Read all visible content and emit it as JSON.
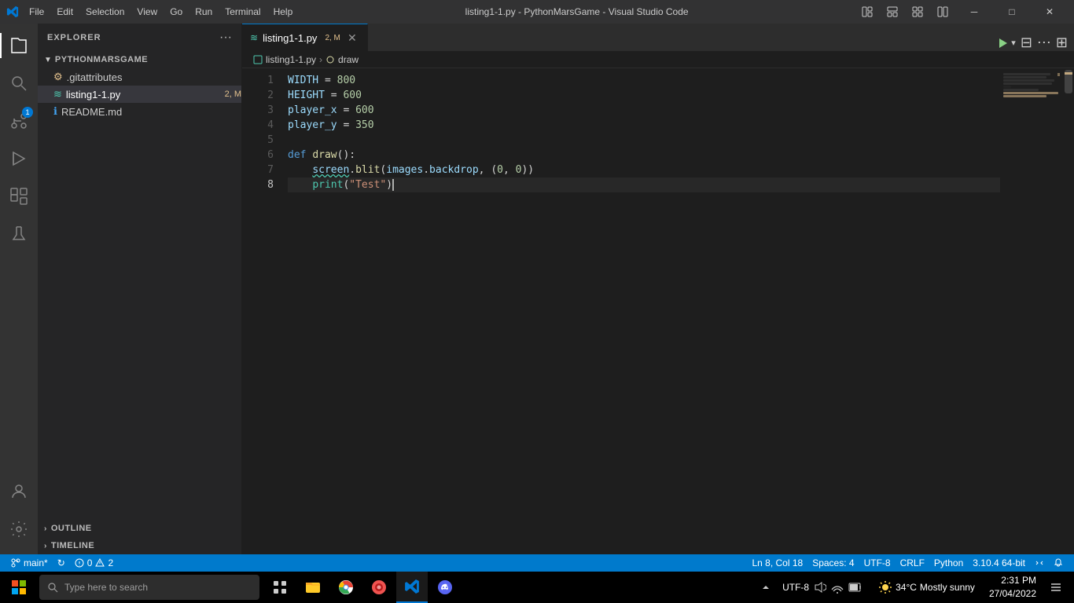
{
  "titlebar": {
    "title": "listing1-1.py - PythonMarsGame - Visual Studio Code",
    "menu": [
      "File",
      "Edit",
      "Selection",
      "View",
      "Go",
      "Run",
      "Terminal",
      "Help"
    ]
  },
  "activity_bar": {
    "icons": [
      {
        "name": "explorer-icon",
        "symbol": "⬜",
        "active": true,
        "badge": null
      },
      {
        "name": "search-icon",
        "symbol": "🔍",
        "active": false,
        "badge": null
      },
      {
        "name": "source-control-icon",
        "symbol": "⑂",
        "active": false,
        "badge": "1"
      },
      {
        "name": "run-icon",
        "symbol": "▷",
        "active": false,
        "badge": null
      },
      {
        "name": "extensions-icon",
        "symbol": "⧉",
        "active": false,
        "badge": null
      },
      {
        "name": "flask-icon",
        "symbol": "⚗",
        "active": false,
        "badge": null
      }
    ],
    "bottom_icons": [
      {
        "name": "account-icon",
        "symbol": "👤"
      },
      {
        "name": "settings-icon",
        "symbol": "⚙"
      }
    ]
  },
  "sidebar": {
    "title": "EXPLORER",
    "project": "PYTHONMARSGAME",
    "files": [
      {
        "name": ".gitattributes",
        "icon": "⚙",
        "color": "#cccccc",
        "indent": 1
      },
      {
        "name": "listing1-1.py",
        "icon": "🐍",
        "color": "#4ec9b0",
        "modified": "2, M",
        "active": true,
        "indent": 1
      },
      {
        "name": "README.md",
        "icon": "ℹ",
        "color": "#cccccc",
        "indent": 1
      }
    ],
    "outline_label": "OUTLINE",
    "timeline_label": "TIMELINE"
  },
  "tabs": [
    {
      "label": "listing1-1.py",
      "modified": "2, M",
      "active": true,
      "icon": "🐍"
    }
  ],
  "breadcrumb": {
    "file": "listing1-1.py",
    "symbol": "draw"
  },
  "code": {
    "lines": [
      {
        "num": 1,
        "content": "WIDTH = 800",
        "tokens": [
          {
            "text": "WIDTH",
            "class": "var"
          },
          {
            "text": " = ",
            "class": "op"
          },
          {
            "text": "800",
            "class": "num"
          }
        ]
      },
      {
        "num": 2,
        "content": "HEIGHT = 600",
        "tokens": [
          {
            "text": "HEIGHT",
            "class": "var"
          },
          {
            "text": " = ",
            "class": "op"
          },
          {
            "text": "600",
            "class": "num"
          }
        ]
      },
      {
        "num": 3,
        "content": "player_x = 600",
        "tokens": [
          {
            "text": "player_x",
            "class": "var"
          },
          {
            "text": " = ",
            "class": "op"
          },
          {
            "text": "600",
            "class": "num"
          }
        ]
      },
      {
        "num": 4,
        "content": "player_y = 350",
        "tokens": [
          {
            "text": "player_y",
            "class": "var"
          },
          {
            "text": " = ",
            "class": "op"
          },
          {
            "text": "350",
            "class": "num"
          }
        ]
      },
      {
        "num": 5,
        "content": "",
        "tokens": []
      },
      {
        "num": 6,
        "content": "def draw():",
        "tokens": [
          {
            "text": "def",
            "class": "kw"
          },
          {
            "text": " ",
            "class": "punc"
          },
          {
            "text": "draw",
            "class": "fn"
          },
          {
            "text": "():",
            "class": "punc"
          }
        ]
      },
      {
        "num": 7,
        "content": "    screen.blit(images.backdrop, (0, 0))",
        "tokens": [
          {
            "text": "    ",
            "class": "punc"
          },
          {
            "text": "screen",
            "class": "var"
          },
          {
            "text": ".",
            "class": "punc"
          },
          {
            "text": "blit",
            "class": "method"
          },
          {
            "text": "(",
            "class": "punc"
          },
          {
            "text": "images",
            "class": "var"
          },
          {
            "text": ".",
            "class": "punc"
          },
          {
            "text": "backdrop",
            "class": "attr"
          },
          {
            "text": ", (",
            "class": "punc"
          },
          {
            "text": "0",
            "class": "num"
          },
          {
            "text": ", ",
            "class": "punc"
          },
          {
            "text": "0",
            "class": "num"
          },
          {
            "text": "))",
            "class": "punc"
          }
        ]
      },
      {
        "num": 8,
        "content": "    print(\"Test\")",
        "tokens": [
          {
            "text": "    ",
            "class": "punc"
          },
          {
            "text": "print",
            "class": "builtin"
          },
          {
            "text": "(",
            "class": "punc"
          },
          {
            "text": "\"Test\"",
            "class": "str"
          },
          {
            "text": ")",
            "class": "punc"
          }
        ],
        "current": true
      }
    ]
  },
  "status_bar": {
    "branch": "main*",
    "sync": "↻",
    "errors": "0",
    "warnings": "2",
    "position": "Ln 8, Col 18",
    "spaces": "Spaces: 4",
    "encoding": "UTF-8",
    "line_ending": "CRLF",
    "language": "Python",
    "python_version": "3.10.4 64-bit",
    "remote_icon": "⚡",
    "notifications": "🔔"
  },
  "taskbar": {
    "search_placeholder": "Type here to search",
    "apps": [
      {
        "name": "task-view-icon",
        "label": "Task View"
      },
      {
        "name": "file-explorer-icon",
        "label": "File Explorer"
      },
      {
        "name": "chrome-icon",
        "label": "Google Chrome"
      },
      {
        "name": "chromium-icon",
        "label": "Chromium"
      },
      {
        "name": "vscode-icon",
        "label": "VS Code"
      },
      {
        "name": "discord-icon",
        "label": "Discord"
      }
    ],
    "weather": {
      "temp": "34°C",
      "condition": "Mostly sunny"
    },
    "time": "2:31 PM",
    "date": "27/04/2022"
  }
}
